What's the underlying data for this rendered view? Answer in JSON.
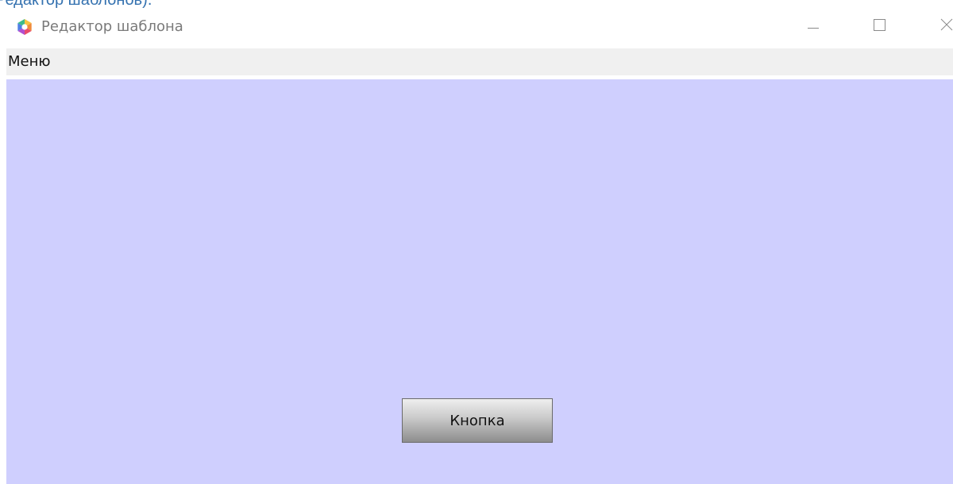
{
  "top_link_fragment": "Редактор шаблонов).",
  "window": {
    "title": "Редактор шаблона",
    "icon": "hexagon-logo-icon",
    "controls": {
      "minimize_icon": "minimize-icon",
      "maximize_icon": "maximize-icon",
      "close_icon": "close-icon"
    }
  },
  "menubar": {
    "items": [
      {
        "label": "Меню"
      }
    ]
  },
  "canvas": {
    "background_color": "#cfcffe",
    "button": {
      "label": "Кнопка"
    }
  },
  "colors": {
    "link": "#3572b0",
    "menubar_bg": "#f0f0f0",
    "title_text": "#7a7a7a"
  }
}
